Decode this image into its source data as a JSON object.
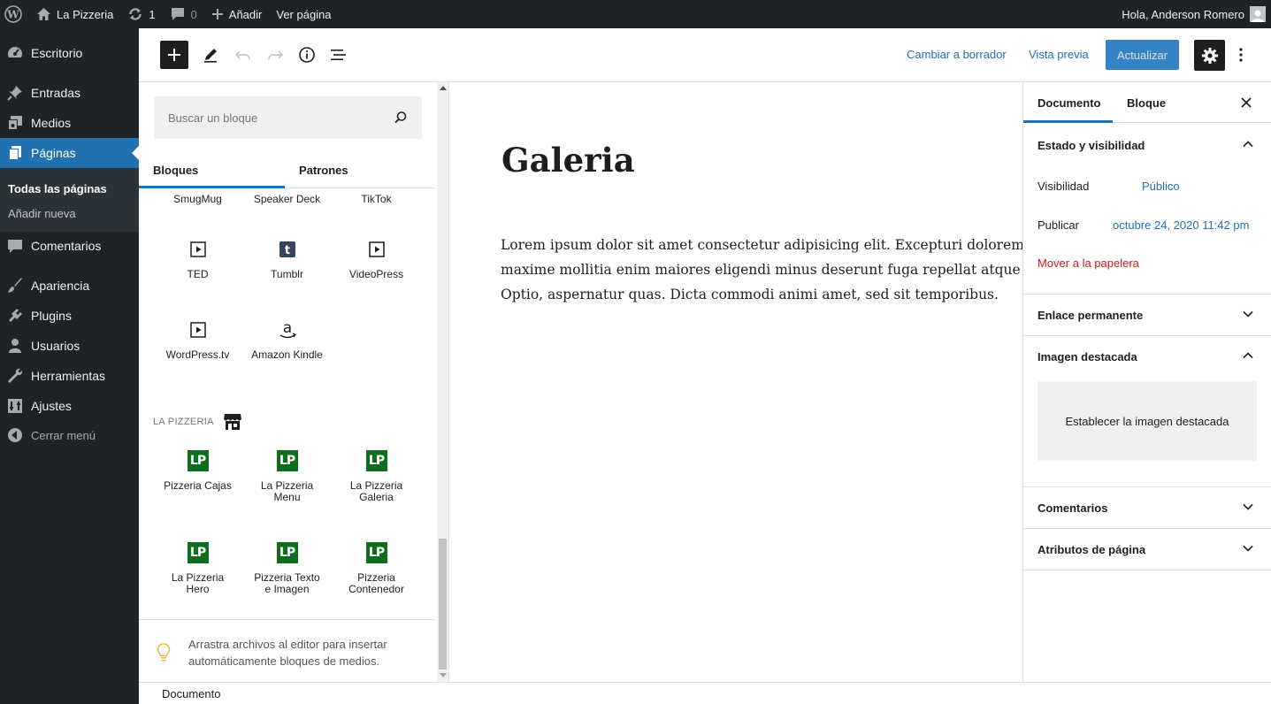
{
  "adminbar": {
    "site_name": "La Pizzeria",
    "updates_count": "1",
    "comments_count": "0",
    "add_new": "Añadir",
    "view_page": "Ver página",
    "greeting": "Hola, Anderson Romero"
  },
  "menu": {
    "dashboard": "Escritorio",
    "posts": "Entradas",
    "media": "Medios",
    "pages": "Páginas",
    "sub_all_pages": "Todas las páginas",
    "sub_add_new": "Añadir nueva",
    "comments": "Comentarios",
    "appearance": "Apariencia",
    "plugins": "Plugins",
    "users": "Usuarios",
    "tools": "Herramientas",
    "settings": "Ajustes",
    "collapse": "Cerrar menú"
  },
  "header": {
    "switch_to_draft": "Cambiar a borrador",
    "preview": "Vista previa",
    "update": "Actualizar"
  },
  "inserter": {
    "search_placeholder": "Buscar un bloque",
    "tab_blocks": "Bloques",
    "tab_patterns": "Patrones",
    "partial_row": [
      "SmugMug",
      "Speaker Deck",
      "TikTok"
    ],
    "embed_blocks": [
      {
        "label": "TED",
        "icon": "embed-video-icon"
      },
      {
        "label": "Tumblr",
        "icon": "tumblr-icon"
      },
      {
        "label": "VideoPress",
        "icon": "embed-video-icon"
      },
      {
        "label": "WordPress.tv",
        "icon": "embed-video-icon"
      },
      {
        "label": "Amazon Kindle",
        "icon": "amazon-icon"
      }
    ],
    "category_title": "LA PIZZERIA",
    "lp_icon_text": "LP",
    "pizzeria_blocks": [
      {
        "label": "Pizzeria Cajas"
      },
      {
        "label": "La Pizzeria Menu"
      },
      {
        "label": "La Pizzeria Galeria"
      },
      {
        "label": "La Pizzeria Hero"
      },
      {
        "label": "Pizzeria Texto e Imagen"
      },
      {
        "label": "Pizzeria Contenedor"
      }
    ],
    "tip": "Arrastra archivos al editor para insertar automáticamente bloques de medios."
  },
  "canvas": {
    "title": "Galeria",
    "paragraph": "Lorem ipsum dolor sit amet consectetur adipisicing elit. Excepturi dolorem maxime mollitia enim maiores eligendi minus deserunt fuga repellat atque! Optio, aspernatur quas. Dicta commodi animi amet, sed sit temporibus."
  },
  "sidebar": {
    "tab_document": "Documento",
    "tab_block": "Bloque",
    "status_title": "Estado y visibilidad",
    "visibility_label": "Visibilidad",
    "visibility_value": "Público",
    "publish_label": "Publicar",
    "publish_value": "octubre 24, 2020 11:42 pm",
    "trash": "Mover a la papelera",
    "permalink_title": "Enlace permanente",
    "featured_title": "Imagen destacada",
    "featured_button": "Establecer la imagen destacada",
    "comments_title": "Comentarios",
    "page_attributes_title": "Atributos de página"
  },
  "footer": {
    "breadcrumb": "Documento"
  },
  "colors": {
    "admin_dark": "#1d2327",
    "accent": "#2271b1",
    "danger": "#cc1818",
    "lp_green": "#0f6e1e"
  }
}
